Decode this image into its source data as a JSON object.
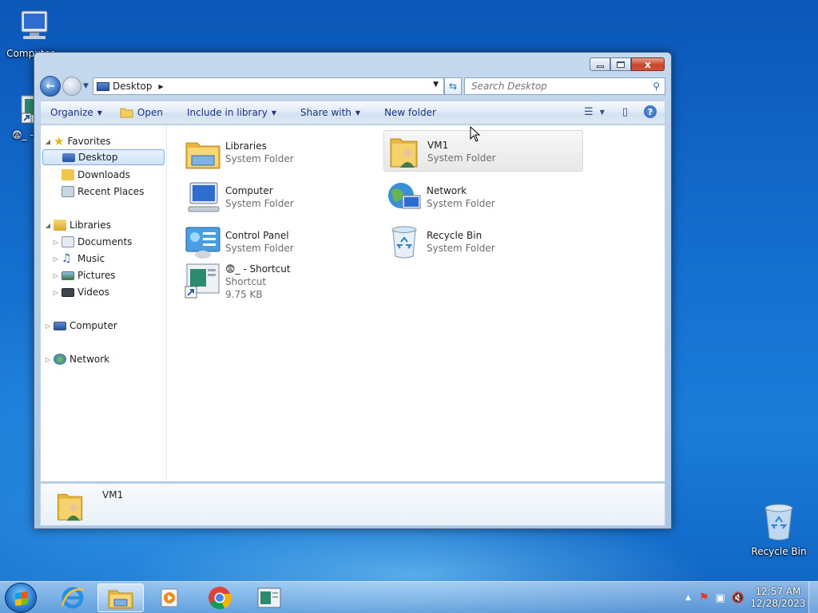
{
  "desktop": {
    "icons": [
      {
        "label": "Computer",
        "icon": "computer-icon"
      },
      {
        "label": "😨_ - Sh",
        "icon": "shortcut-icon"
      },
      {
        "label": "Recycle Bin",
        "icon": "recycle-bin-icon"
      }
    ]
  },
  "window": {
    "caption": {
      "minimize": "minimize",
      "maximize": "maximize",
      "close": "x"
    },
    "address": {
      "crumb": "Desktop"
    },
    "search": {
      "placeholder": "Search Desktop"
    },
    "toolbar": {
      "organize": "Organize",
      "open": "Open",
      "include": "Include in library",
      "share": "Share with",
      "new_folder": "New folder"
    },
    "nav": {
      "favorites": "Favorites",
      "desktop": "Desktop",
      "downloads": "Downloads",
      "recent": "Recent Places",
      "libraries": "Libraries",
      "documents": "Documents",
      "music": "Music",
      "pictures": "Pictures",
      "videos": "Videos",
      "computer": "Computer",
      "network": "Network"
    },
    "items": [
      {
        "name": "Libraries",
        "sub": "System Folder"
      },
      {
        "name": "VM1",
        "sub": "System Folder"
      },
      {
        "name": "Computer",
        "sub": "System Folder"
      },
      {
        "name": "Network",
        "sub": "System Folder"
      },
      {
        "name": "Control Panel",
        "sub": "System Folder"
      },
      {
        "name": "Recycle Bin",
        "sub": "System Folder"
      },
      {
        "name": "😨_ - Shortcut",
        "sub": "Shortcut",
        "size": "9.75 KB"
      }
    ],
    "details": {
      "name": "VM1"
    }
  },
  "taskbar": {
    "time": "12:57 AM",
    "date": "12/28/2023"
  },
  "colors": {
    "accent": "#1e3287",
    "selection": "#cfe4fa",
    "close": "#c8442d"
  }
}
